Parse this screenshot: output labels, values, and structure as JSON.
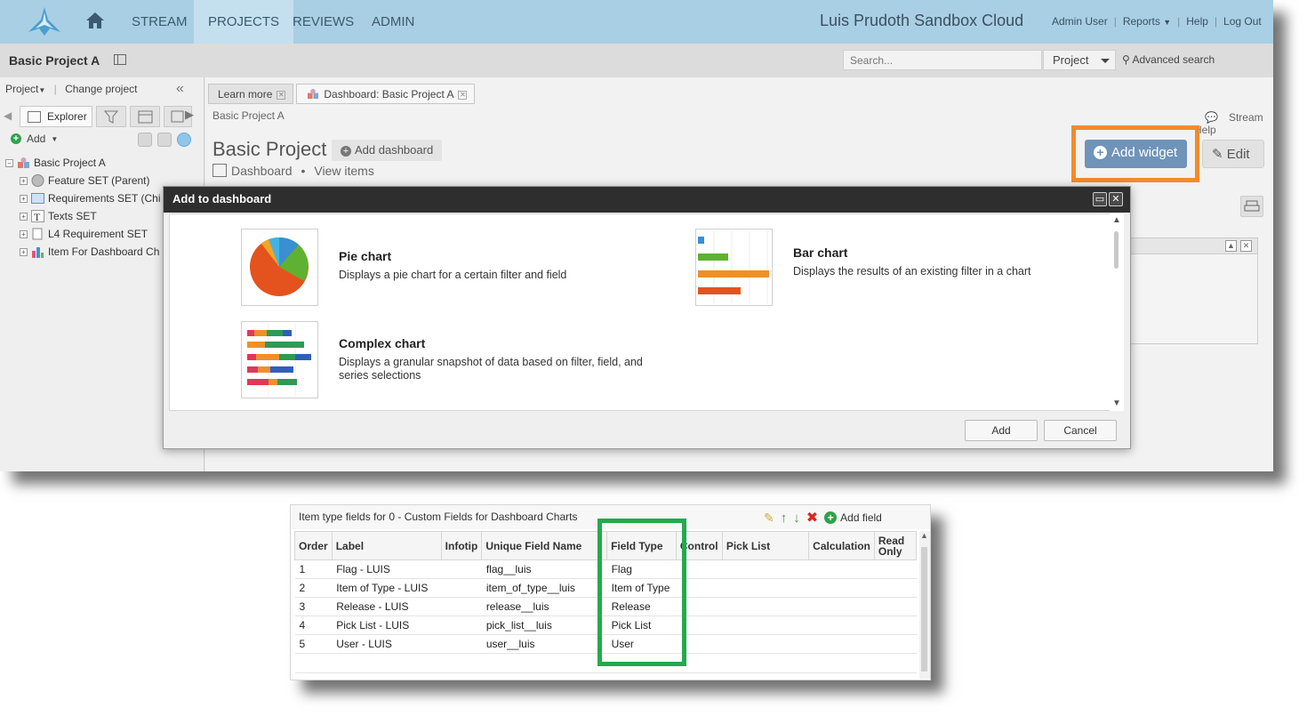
{
  "topnav": {
    "links": [
      "STREAM",
      "PROJECTS",
      "REVIEWS",
      "ADMIN"
    ],
    "active": "PROJECTS",
    "cloud_title": "Luis Prudoth Sandbox Cloud",
    "right_links": [
      "Admin User",
      "Reports",
      "Help",
      "Log Out"
    ]
  },
  "subbar": {
    "project_name": "Basic Project A",
    "search_placeholder": "Search...",
    "search_scope": "Project",
    "advanced_search": "Advanced search"
  },
  "left_panel": {
    "project_menu": "Project",
    "change_project": "Change project",
    "explorer_tab": "Explorer",
    "add_label": "Add",
    "tree": [
      {
        "label": "Basic Project A",
        "level": 0
      },
      {
        "label": "Feature SET (Parent)",
        "level": 1
      },
      {
        "label": "Requirements SET (Chi",
        "level": 1
      },
      {
        "label": "Texts SET",
        "level": 1
      },
      {
        "label": "L4 Requirement SET",
        "level": 1
      },
      {
        "label": "Item For Dashboard Ch",
        "level": 1
      }
    ]
  },
  "main": {
    "tabs": [
      "Learn more",
      "Dashboard: Basic Project A"
    ],
    "breadcrumb": "Basic Project A",
    "stream_link": "Stream",
    "help_link": "Help",
    "page_title": "Basic Project",
    "add_dashboard": "Add dashboard",
    "dashboard_label": "Dashboard",
    "view_items": "View items",
    "add_widget": "Add widget",
    "edit": "Edit"
  },
  "modal": {
    "title": "Add to dashboard",
    "cards": [
      {
        "title": "Pie chart",
        "desc": "Displays a pie chart for a certain filter and field"
      },
      {
        "title": "Bar chart",
        "desc": "Displays the results of an existing filter in a chart"
      },
      {
        "title": "Complex chart",
        "desc": "Displays a granular snapshot of data based on filter, field, and series selections"
      }
    ],
    "add_button": "Add",
    "cancel_button": "Cancel"
  },
  "fields_panel": {
    "title": "Item type fields for 0 - Custom Fields for Dashboard Charts",
    "add_field": "Add field",
    "columns": [
      "Order",
      "Label",
      "Infotip",
      "Unique Field Name",
      "Field Type",
      "Control",
      "Pick List",
      "Calculation",
      "Read Only"
    ],
    "rows": [
      {
        "order": "1",
        "label": "Flag - LUIS",
        "unique": "flag__luis",
        "type": "Flag"
      },
      {
        "order": "2",
        "label": "Item of Type - LUIS",
        "unique": "item_of_type__luis",
        "type": "Item of Type"
      },
      {
        "order": "3",
        "label": "Release - LUIS",
        "unique": "release__luis",
        "type": "Release"
      },
      {
        "order": "4",
        "label": "Pick List - LUIS",
        "unique": "pick_list__luis",
        "type": "Pick List"
      },
      {
        "order": "5",
        "label": "User - LUIS",
        "unique": "user__luis",
        "type": "User"
      }
    ]
  },
  "colors": {
    "nav_bg": "#a9cfe4",
    "highlight_orange": "#f58a2a",
    "highlight_green": "#23aa4a",
    "widget_button": "#6f93b9"
  }
}
